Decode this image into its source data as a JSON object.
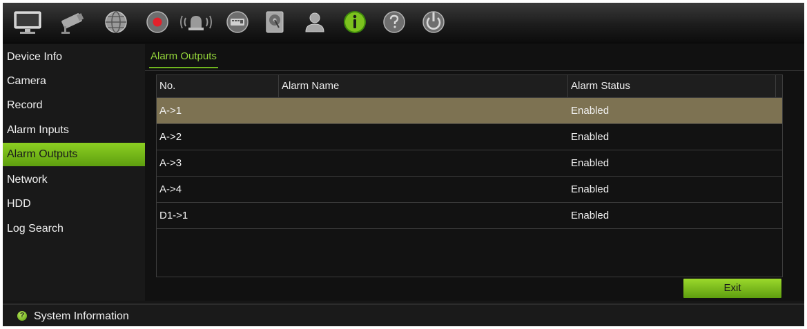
{
  "toolbar": {
    "icons": [
      "live-view-monitor-icon",
      "camera-icon",
      "network-globe-icon",
      "record-icon",
      "alarm-icon",
      "device-icon",
      "hdd-icon",
      "user-icon",
      "information-icon",
      "help-icon",
      "power-icon"
    ],
    "active_icon": "information-icon"
  },
  "sidebar": {
    "items": [
      {
        "label": "Device Info"
      },
      {
        "label": "Camera"
      },
      {
        "label": "Record"
      },
      {
        "label": "Alarm Inputs"
      },
      {
        "label": "Alarm Outputs"
      },
      {
        "label": "Network"
      },
      {
        "label": "HDD"
      },
      {
        "label": "Log Search"
      }
    ],
    "active_label": "Alarm Outputs"
  },
  "main": {
    "tab_label": "Alarm Outputs",
    "table": {
      "columns": [
        "No.",
        "Alarm Name",
        "Alarm Status"
      ],
      "rows": [
        {
          "no": "A->1",
          "name": "",
          "status": "Enabled"
        },
        {
          "no": "A->2",
          "name": "",
          "status": "Enabled"
        },
        {
          "no": "A->3",
          "name": "",
          "status": "Enabled"
        },
        {
          "no": "A->4",
          "name": "",
          "status": "Enabled"
        },
        {
          "no": "D1->1",
          "name": "",
          "status": "Enabled"
        }
      ],
      "selected_row": "A->1"
    },
    "exit_label": "Exit"
  },
  "statusbar": {
    "icon": "help-question-icon",
    "text": "System Information"
  },
  "colors": {
    "accent_green": "#7cc21e",
    "selected_row": "#7d7252",
    "background": "#161616"
  }
}
